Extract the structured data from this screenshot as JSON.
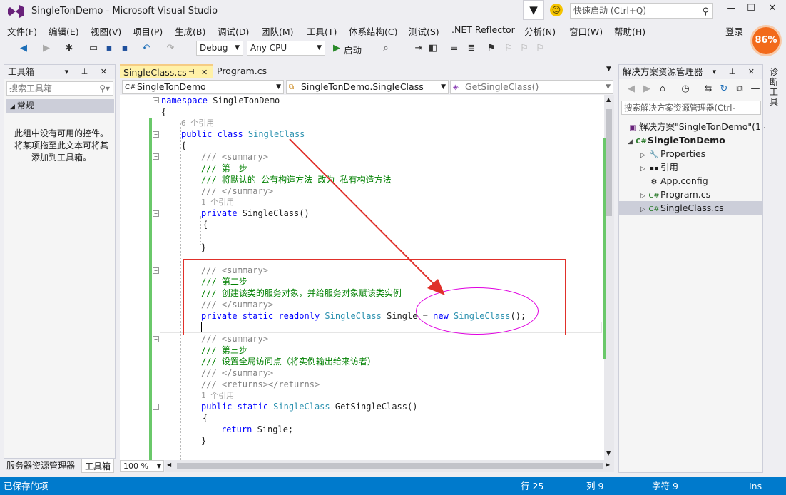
{
  "window": {
    "title": "SingleTonDemo - Microsoft Visual Studio",
    "quick_launch_placeholder": "快速启动 (Ctrl+Q)",
    "login_label": "登录",
    "perf_badge": "86%"
  },
  "menu": [
    "文件(F)",
    "编辑(E)",
    "视图(V)",
    "项目(P)",
    "生成(B)",
    "调试(D)",
    "团队(M)",
    "工具(T)",
    "体系结构(C)",
    "测试(S)",
    ".NET Reflector",
    "分析(N)",
    "窗口(W)",
    "帮助(H)"
  ],
  "toolbar": {
    "config": "Debug",
    "platform": "Any CPU",
    "start_label": "启动"
  },
  "toolbox": {
    "title": "工具箱",
    "search_placeholder": "搜索工具箱",
    "group": "常规",
    "empty_message": "此组中没有可用的控件。将某项拖至此文本可将其添加到工具箱。",
    "tabs": [
      "服务器资源管理器",
      "工具箱"
    ]
  },
  "editor": {
    "tabs": [
      "SingleClass.cs",
      "Program.cs"
    ],
    "nav": {
      "project": "SingleTonDemo",
      "type": "SingleTonDemo.SingleClass",
      "member": "GetSingleClass()"
    },
    "zoom": "100 %",
    "code": {
      "l1_kw": "namespace",
      "l1_name": " SingleTonDemo",
      "l2": "{",
      "ref6": "6 个引用",
      "l3_kw": "public class",
      "l3_type": " SingleClass",
      "l4": "{",
      "c1": "/// <summary>",
      "c2": "/// 第一步",
      "c3": "/// 将默认的 公有构造方法 改为 私有构造方法",
      "c4": "/// </summary>",
      "ref1a": "1 个引用",
      "l5_kw": "private",
      "l5_rest": " SingleClass()",
      "l6": "{",
      "l7": "}",
      "d1": "/// <summary>",
      "d2": "/// 第二步",
      "d3": "/// 创建该类的服务对象，并给服务对象赋该类实例",
      "d4": "/// </summary>",
      "l8_kw": "private static readonly",
      "l8_type": " SingleClass",
      "l8_mid": " Single = ",
      "l8_new": "new",
      "l8_type2": " SingleClass",
      "l8_end": "();",
      "e1": "/// <summary>",
      "e2": "/// 第三步",
      "e3": "/// 设置全局访问点（将实例输出给来访者）",
      "e4": "/// </summary>",
      "e5": "/// <returns></returns>",
      "ref1b": "1 个引用",
      "l9_kw": "public static",
      "l9_type": " SingleClass",
      "l9_rest": " GetSingleClass()",
      "l10": "{",
      "l11_kw": "return",
      "l11_rest": " Single;",
      "l12": "}"
    }
  },
  "solution_explorer": {
    "title": "解决方案资源管理器",
    "search_placeholder": "搜索解决方案资源管理器(Ctrl-",
    "solution": "解决方案\"SingleTonDemo\"(1 -",
    "project": "SingleTonDemo",
    "items": [
      "Properties",
      "引用",
      "App.config",
      "Program.cs",
      "SingleClass.cs"
    ]
  },
  "side_tab": "诊断工具",
  "status": {
    "message": "已保存的项",
    "line": "行 25",
    "col": "列 9",
    "char": "字符 9",
    "mode": "Ins"
  },
  "colors": {
    "accent": "#007acc",
    "annotation_box": "#e0302a",
    "annotation_ellipse": "#e000e0",
    "keyword": "#0000ff",
    "type": "#2b91af",
    "comment": "#008000"
  }
}
